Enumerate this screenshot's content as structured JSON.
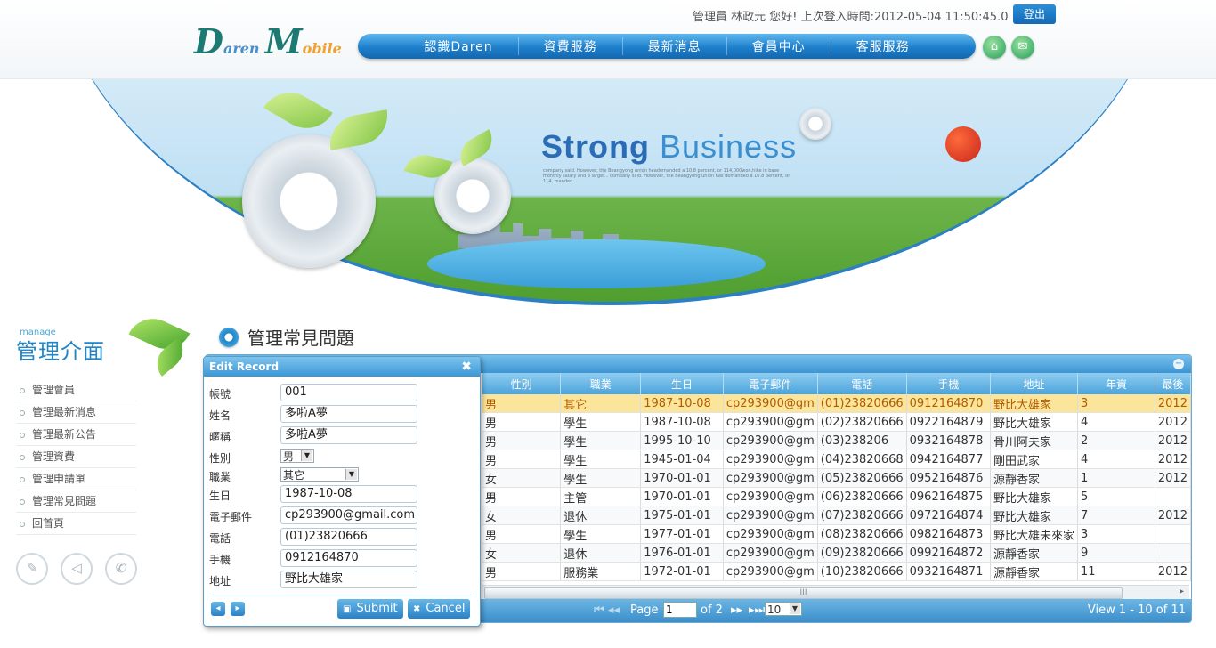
{
  "header": {
    "user_info": "管理員 林政元 您好! 上次登入時間:2012-05-04 11:50:45.0",
    "logout_label": "登出",
    "logo": {
      "d": "D",
      "aren": "aren",
      "m": "M",
      "obile": "obile"
    },
    "nav": [
      "認識Daren",
      "資費服務",
      "最新消息",
      "會員中心",
      "客服服務"
    ]
  },
  "banner": {
    "title_strong": "Strong",
    "title_business": "Business",
    "subtitle": "company said. However, the Beangyong union heademanded a 10.8 percent, or 114,000won,hike in base monthly salary and a larger... company said. However, the Beangyong union has demanded a 10.8 percent, or 114, manded"
  },
  "sidebar": {
    "title_en": "manage",
    "title": "管理介面",
    "items": [
      "管理會員",
      "管理最新消息",
      "管理最新公告",
      "管理資費",
      "管理申請單",
      "管理常見問題",
      "回首頁"
    ]
  },
  "main": {
    "title": "管理常見問題"
  },
  "grid": {
    "columns": [
      "性別",
      "職業",
      "生日",
      "電子郵件",
      "電話",
      "手機",
      "地址",
      "年資",
      "最後"
    ],
    "rows": [
      [
        "男",
        "其它",
        "1987-10-08",
        "cp293900@gm",
        "(01)23820666",
        "0912164870",
        "野比大雄家",
        "3",
        "2012"
      ],
      [
        "男",
        "學生",
        "1987-10-08",
        "cp293900@gm",
        "(02)23820666",
        "0922164879",
        "野比大雄家",
        "4",
        "2012"
      ],
      [
        "男",
        "學生",
        "1995-10-10",
        "cp293900@gm",
        "(03)238206",
        "0932164878",
        "骨川阿夫家",
        "2",
        "2012"
      ],
      [
        "男",
        "學生",
        "1945-01-04",
        "cp293900@gm",
        "(04)23820668",
        "0942164877",
        "剛田武家",
        "4",
        "2012"
      ],
      [
        "女",
        "學生",
        "1970-01-01",
        "cp293900@gm",
        "(05)23820666",
        "0952164876",
        "源靜香家",
        "1",
        "2012"
      ],
      [
        "男",
        "主管",
        "1970-01-01",
        "cp293900@gm",
        "(06)23820666",
        "0962164875",
        "野比大雄家",
        "5",
        ""
      ],
      [
        "女",
        "退休",
        "1975-01-01",
        "cp293900@gm",
        "(07)23820666",
        "0972164874",
        "野比大雄家",
        "7",
        "2012"
      ],
      [
        "男",
        "學生",
        "1977-01-01",
        "cp293900@gm",
        "(08)23820666",
        "0982164873",
        "野比大雄未來家",
        "3",
        ""
      ],
      [
        "女",
        "退休",
        "1976-01-01",
        "cp293900@gm",
        "(09)23820666",
        "0992164872",
        "源靜香家",
        "9",
        ""
      ],
      [
        "男",
        "服務業",
        "1972-01-01",
        "cp293900@gm",
        "(10)23820666",
        "0932164871",
        "源靜香家",
        "11",
        "2012"
      ]
    ],
    "selected_row": 0,
    "scroll_label": "III",
    "pager": {
      "first": "⏮",
      "prev": "◂◂",
      "page_label": "Page",
      "page_value": "1",
      "of_label": "of 2",
      "next": "▸▸",
      "last": "▸⏭",
      "page_size": "10",
      "view_text": "View 1 - 10 of 11"
    }
  },
  "dialog": {
    "title": "Edit Record",
    "close": "✖",
    "fields": [
      {
        "label": "帳號",
        "value": "001",
        "type": "text"
      },
      {
        "label": "姓名",
        "value": "多啦A夢",
        "type": "text"
      },
      {
        "label": "暱稱",
        "value": "多啦A夢",
        "type": "text"
      },
      {
        "label": "性別",
        "value": "男",
        "type": "select-small"
      },
      {
        "label": "職業",
        "value": "其它",
        "type": "select-med"
      },
      {
        "label": "生日",
        "value": "1987-10-08",
        "type": "text"
      },
      {
        "label": "電子郵件",
        "value": "cp293900@gmail.com",
        "type": "text"
      },
      {
        "label": "電話",
        "value": "(01)23820666",
        "type": "text"
      },
      {
        "label": "手機",
        "value": "0912164870",
        "type": "text"
      },
      {
        "label": "地址",
        "value": "野比大雄家",
        "type": "text"
      }
    ],
    "prev_icon": "◂",
    "next_icon": "▸",
    "submit_label": "Submit",
    "cancel_label": "Cancel"
  },
  "colors": {
    "accent": "#1d7fcc",
    "selected_row": "#fbe59a",
    "header_bar": "#3d95d3"
  }
}
